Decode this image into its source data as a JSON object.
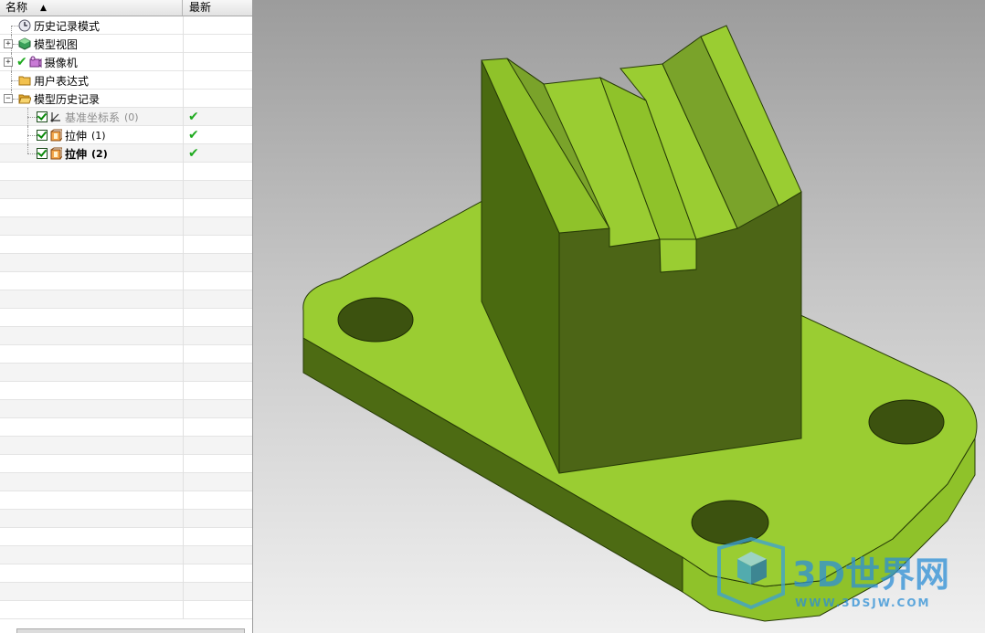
{
  "navigator": {
    "columns": {
      "name": "名称",
      "latest": "最新"
    },
    "nodes": [
      {
        "label": "历史记录模式",
        "icon": "clock-icon",
        "latest": ""
      },
      {
        "label": "模型视图",
        "icon": "model-views-icon",
        "latest": ""
      },
      {
        "label": "摄像机",
        "icon": "camera-icon",
        "latest": ""
      },
      {
        "label": "用户表达式",
        "icon": "folder-icon",
        "latest": ""
      },
      {
        "label": "模型历史记录",
        "icon": "open-folder-icon",
        "latest": ""
      },
      {
        "label": "基准坐标系",
        "suffix": "(0)",
        "icon": "datum-csys-icon",
        "latest": "✔"
      },
      {
        "label": "拉伸",
        "suffix": "(1)",
        "icon": "extrude-icon",
        "latest": "✔"
      },
      {
        "label": "拉伸",
        "suffix": "(2)",
        "icon": "extrude-icon",
        "latest": "✔"
      }
    ]
  },
  "viewport": {
    "model_color": "#9ACD32",
    "watermark": {
      "brand": "3D世界网",
      "url": "WWW.3DSJW.COM"
    }
  },
  "colors": {
    "check_green": "#1faa1f",
    "part_light": "#9ACD32",
    "part_dark": "#4A5F1A"
  }
}
